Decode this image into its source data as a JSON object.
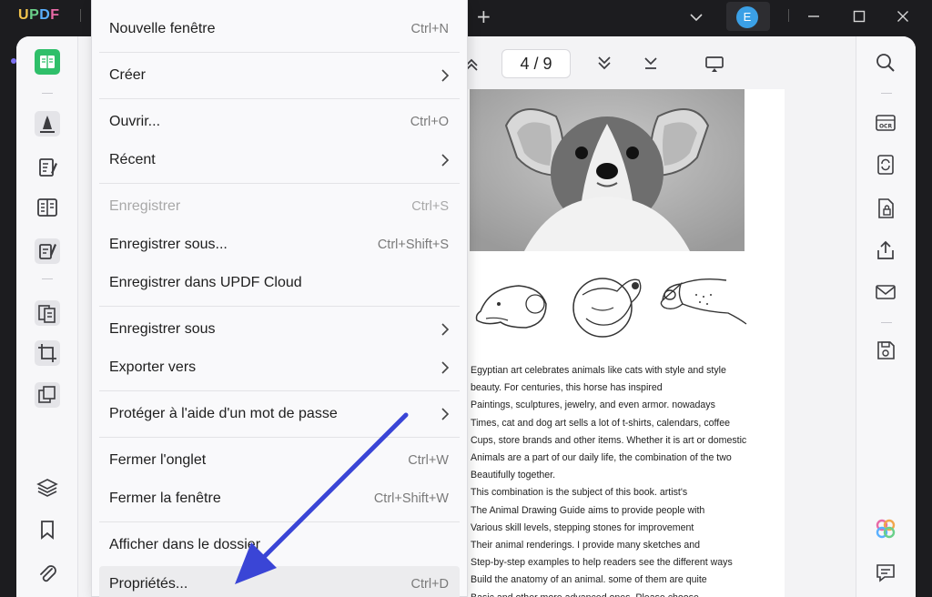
{
  "app": {
    "logo": [
      "U",
      "P",
      "D",
      "F"
    ],
    "avatar_initial": "E",
    "accent": "#3ba0e6"
  },
  "toolbar": {
    "page_current": "4",
    "page_sep": "/",
    "page_total": "9"
  },
  "menu": {
    "items": [
      {
        "label": "Nouvelle fenêtre",
        "shortcut": "Ctrl+N"
      },
      {
        "label": "Créer",
        "shortcut": ""
      },
      {
        "label": "Ouvrir...",
        "shortcut": "Ctrl+O"
      },
      {
        "label": "Récent",
        "shortcut": ""
      },
      {
        "label": "Enregistrer",
        "shortcut": "Ctrl+S"
      },
      {
        "label": "Enregistrer sous...",
        "shortcut": "Ctrl+Shift+S"
      },
      {
        "label": "Enregistrer dans UPDF Cloud",
        "shortcut": ""
      },
      {
        "label": "Enregistrer sous",
        "shortcut": ""
      },
      {
        "label": "Exporter vers",
        "shortcut": ""
      },
      {
        "label": "Protéger à l'aide d'un mot de passe",
        "shortcut": ""
      },
      {
        "label": "Fermer l'onglet",
        "shortcut": "Ctrl+W"
      },
      {
        "label": "Fermer la fenêtre",
        "shortcut": "Ctrl+Shift+W"
      },
      {
        "label": "Afficher dans le dossier",
        "shortcut": ""
      },
      {
        "label": "Propriétés...",
        "shortcut": "Ctrl+D"
      }
    ]
  },
  "document": {
    "lines": [
      "Egyptian art celebrates animals like cats with style and style",
      "beauty. For centuries, this horse has inspired",
      "Paintings, sculptures, jewelry, and even armor. nowadays",
      "Times, cat and dog art sells a lot of t-shirts, calendars, coffee",
      "Cups, store brands and other items. Whether it is art or domestic",
      "Animals are a part of our daily life, the combination of the two",
      "Beautifully together.",
      "This combination is the subject of this book. artist's",
      "The Animal Drawing Guide aims to provide people with",
      "Various skill levels, stepping stones for improvement",
      "Their animal renderings. I provide many sketches and",
      "Step-by-step examples to help readers see the different ways",
      "Build the anatomy of an animal. some of them are quite",
      "Basic and other more advanced ones. Please choose"
    ]
  },
  "colors": {
    "annotation_arrow": "#3a45d6",
    "sidebar_accent": "#2fbf6a"
  }
}
